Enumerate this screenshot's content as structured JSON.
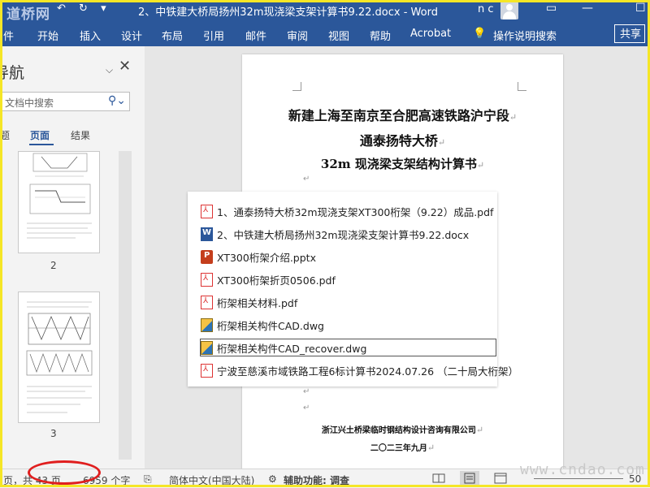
{
  "titlebar": {
    "watermark": "道桥网",
    "doc_title": "2、中铁建大桥局扬州32m现浇梁支架计算书9.22.docx  -  Word",
    "user_initials": "n c"
  },
  "ribbon": {
    "tabs": [
      "件",
      "开始",
      "插入",
      "设计",
      "布局",
      "引用",
      "邮件",
      "审阅",
      "视图",
      "帮助",
      "Acrobat"
    ],
    "tell_me": "操作说明搜索",
    "share": "共享"
  },
  "navpane": {
    "title": "导航",
    "search_placeholder": "文档中搜索",
    "tabs": [
      "题",
      "页面",
      "结果"
    ],
    "active_tab": "页面",
    "page_numbers": [
      "2",
      "3"
    ]
  },
  "document": {
    "title_line1": "新建上海至南京至合肥高速铁路沪宁段",
    "title_line2": "通泰扬特大桥",
    "title_line3": "32m 现浇梁支架结构计算书",
    "company": "浙江兴土桥梁临时钢结构设计咨询有限公司",
    "date": "二〇二三年九月"
  },
  "files": [
    {
      "name": "1、通泰扬特大桥32m现浇支架XT300桁架（9.22）成品.pdf",
      "type": "pdf"
    },
    {
      "name": "2、中铁建大桥局扬州32m现浇梁支架计算书9.22.docx",
      "type": "docx"
    },
    {
      "name": "XT300桁架介绍.pptx",
      "type": "pptx"
    },
    {
      "name": "XT300桁架折页0506.pdf",
      "type": "pdf"
    },
    {
      "name": "桁架相关材料.pdf",
      "type": "pdf"
    },
    {
      "name": "桁架相关构件CAD.dwg",
      "type": "dwg"
    },
    {
      "name": "桁架相关构件CAD_recover.dwg",
      "type": "dwg"
    },
    {
      "name": "宁波至慈溪市域铁路工程6标计算书2024.07.26  （二十局大桁架）",
      "type": "pdf"
    }
  ],
  "statusbar": {
    "page_info": "页，共 43 页",
    "word_count": "6959 个字",
    "language": "简体中文(中国大陆)",
    "accessibility": "辅助功能: 调查",
    "zoom": "50"
  },
  "site_watermark": "www.cndao.com",
  "colors": {
    "word_blue": "#2b579a",
    "yellow_frame": "#f5e626",
    "highlight_red": "#e01e1e"
  }
}
